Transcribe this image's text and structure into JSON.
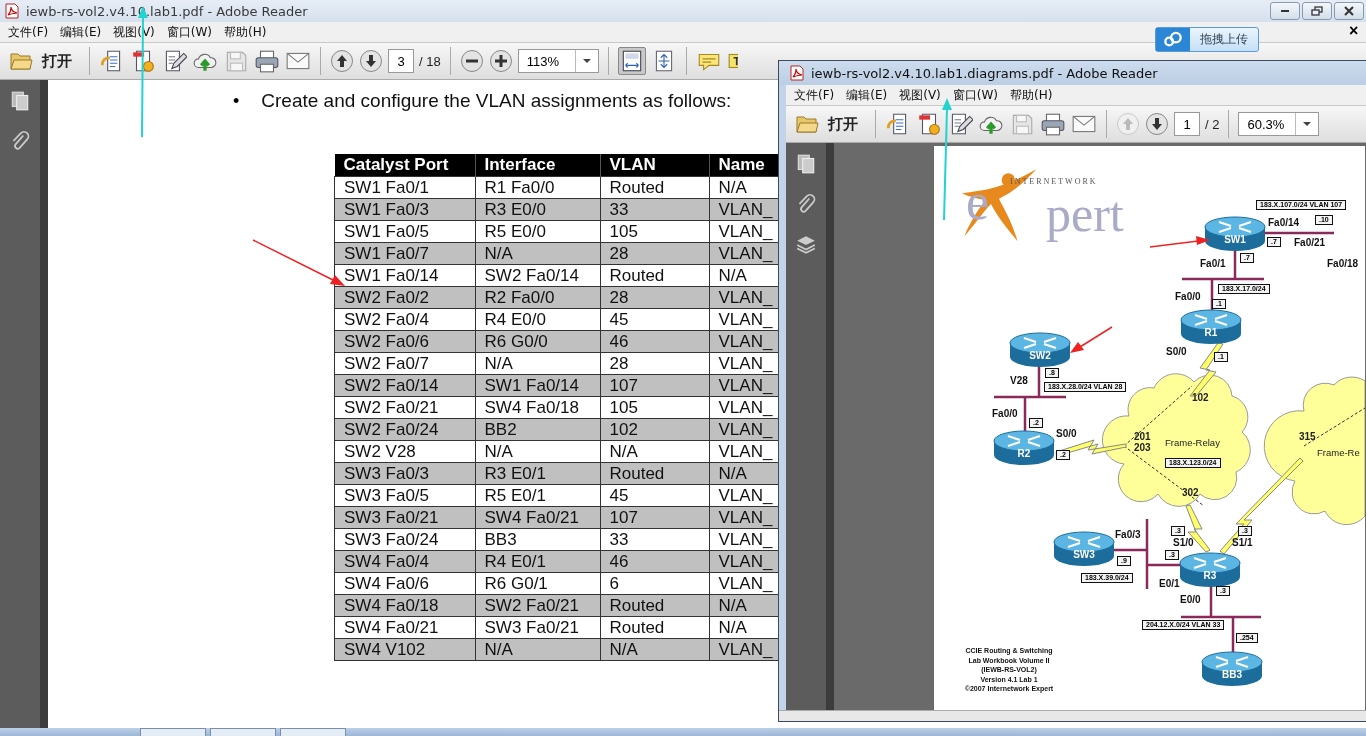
{
  "main_window": {
    "title": "iewb-rs-vol2.v4.10.lab1.pdf - Adobe Reader",
    "menu": [
      "文件(F)",
      "编辑(E)",
      "视图(V)",
      "窗口(W)",
      "帮助(H)"
    ],
    "toolbar": {
      "open_label": "打开",
      "page": "3",
      "page_total": "/ 18",
      "zoom": "113%",
      "prev_page_enabled": true
    }
  },
  "upload_widget": {
    "label": "拖拽上传",
    "close": "×"
  },
  "document": {
    "bullet": "•",
    "text": "Create and configure the VLAN assignments as follows:",
    "table": {
      "columns": [
        "Catalyst Port",
        "Interface",
        "VLAN",
        "Name"
      ],
      "rows": [
        [
          "SW1 Fa0/1",
          "R1 Fa0/0",
          "Routed",
          "N/A"
        ],
        [
          "SW1 Fa0/3",
          "R3 E0/0",
          "33",
          "VLAN_"
        ],
        [
          "SW1 Fa0/5",
          "R5 E0/0",
          "105",
          "VLAN_"
        ],
        [
          "SW1 Fa0/7",
          "N/A",
          "28",
          "VLAN_"
        ],
        [
          "SW1 Fa0/14",
          "SW2 Fa0/14",
          "Routed",
          "N/A"
        ],
        [
          "SW2 Fa0/2",
          "R2 Fa0/0",
          "28",
          "VLAN_"
        ],
        [
          "SW2 Fa0/4",
          "R4 E0/0",
          "45",
          "VLAN_"
        ],
        [
          "SW2 Fa0/6",
          "R6 G0/0",
          "46",
          "VLAN_"
        ],
        [
          "SW2 Fa0/7",
          "N/A",
          "28",
          "VLAN_"
        ],
        [
          "SW2 Fa0/14",
          "SW1 Fa0/14",
          "107",
          "VLAN_"
        ],
        [
          "SW2 Fa0/21",
          "SW4 Fa0/18",
          "105",
          "VLAN_"
        ],
        [
          "SW2 Fa0/24",
          "BB2",
          "102",
          "VLAN_"
        ],
        [
          "SW2 V28",
          "N/A",
          "N/A",
          "VLAN_"
        ],
        [
          "SW3 Fa0/3",
          "R3 E0/1",
          "Routed",
          "N/A"
        ],
        [
          "SW3 Fa0/5",
          "R5 E0/1",
          "45",
          "VLAN_"
        ],
        [
          "SW3 Fa0/21",
          "SW4 Fa0/21",
          "107",
          "VLAN_"
        ],
        [
          "SW3 Fa0/24",
          "BB3",
          "33",
          "VLAN_"
        ],
        [
          "SW4 Fa0/4",
          "R4 E0/1",
          "46",
          "VLAN_"
        ],
        [
          "SW4 Fa0/6",
          "R6 G0/1",
          "6",
          "VLAN_"
        ],
        [
          "SW4 Fa0/18",
          "SW2 Fa0/21",
          "Routed",
          "N/A"
        ],
        [
          "SW4 Fa0/21",
          "SW3 Fa0/21",
          "Routed",
          "N/A"
        ],
        [
          "SW4 V102",
          "N/A",
          "N/A",
          "VLAN_"
        ]
      ]
    }
  },
  "diagram_window": {
    "title": "iewb-rs-vol2.v4.10.lab1.diagrams.pdf - Adobe Reader",
    "menu": [
      "文件(F)",
      "编辑(E)",
      "视图(V)",
      "窗口(W)",
      "帮助(H)"
    ],
    "toolbar": {
      "open_label": "打开",
      "page": "1",
      "page_total": "/ 2",
      "zoom": "60.3%",
      "prev_page_enabled": false
    }
  },
  "diagram": {
    "logo": {
      "top": "INTERNETWORK",
      "left": "e",
      "right": "pert"
    },
    "devices": [
      "SW1",
      "SW2",
      "R1",
      "R2",
      "R3",
      "SW3",
      "BB3"
    ],
    "interfaces": [
      "Fa0/14",
      "Fa0/21",
      "Fa0/18",
      "Fa0/1",
      "Fa0/0",
      "S0/0",
      "V28",
      "Fa0/0",
      "S0/0",
      "Fa0/3",
      "S1/0",
      "S1/1",
      "E0/1",
      "E0/0"
    ],
    "cloud_labels": [
      "102",
      "201",
      "203",
      "Frame-Relay",
      "302",
      "315",
      "Frame-Re"
    ],
    "subnets": [
      "183.X.107.0/24 VLAN 107",
      ".10",
      ".7",
      ".7",
      "183.X.17.0/24",
      ".1",
      ".1",
      ".8",
      "183.X.28.0/24 VLAN 28",
      ".2",
      ".2",
      "183.X.123.0/24",
      ".3",
      ".3",
      ".3",
      ".9",
      "183.X.39.0/24",
      ".3",
      "204.12.X.0/24 VLAN 33",
      ".254"
    ],
    "caption": [
      "CCIE Routing & Switching",
      "Lab Workbook Volume II",
      "(IEWB-RS-VOL2)",
      "Version 4.1 Lab 1",
      "©2007 Internetwork Expert"
    ]
  }
}
